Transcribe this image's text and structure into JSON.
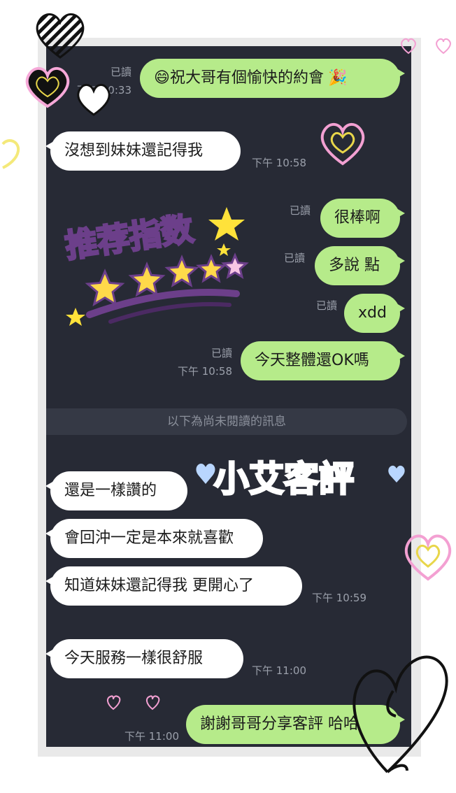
{
  "chat": {
    "messages": [
      {
        "side": "out",
        "text": "祝大哥有個愉快的約會",
        "read": "已讀",
        "time": "下午 10:33"
      },
      {
        "side": "in",
        "text": "沒想到妹妹還記得我",
        "time": "下午 10:58"
      },
      {
        "side": "out",
        "text": "很棒啊",
        "read": "已讀"
      },
      {
        "side": "out",
        "text": "多說 點",
        "read": "已讀"
      },
      {
        "side": "out",
        "text": "xdd",
        "read": "已讀"
      },
      {
        "side": "out",
        "text": "今天整體還OK嗎",
        "read": "已讀",
        "time": "下午 10:58"
      },
      {
        "side": "in",
        "text": "還是一樣讚的"
      },
      {
        "side": "in",
        "text": "會回沖一定是本來就喜歡"
      },
      {
        "side": "in",
        "text": "知道妹妹還記得我 更開心了",
        "time": "下午 10:59"
      },
      {
        "side": "in",
        "text": "今天服務一樣很舒服",
        "time": "下午 11:00"
      },
      {
        "side": "out",
        "text": "謝謝哥哥分享客評 哈哈",
        "time": "下午 11:00"
      }
    ],
    "unread_divider": "以下為尚未閱讀的訊息"
  },
  "overlays": {
    "rating_title": "推荐指数",
    "rating_stars": 5,
    "review_title": "小艾客評"
  },
  "emoji": {
    "smile": "😄",
    "party": "🎉"
  },
  "colors": {
    "chat_bg": "#272a35",
    "outgoing": "#b6eb8a",
    "incoming": "#ffffff",
    "meta": "#9ba0ab",
    "star": "#ffd94a",
    "title_pink": "#f7c6e4",
    "title_purple": "#6c3f8a"
  }
}
